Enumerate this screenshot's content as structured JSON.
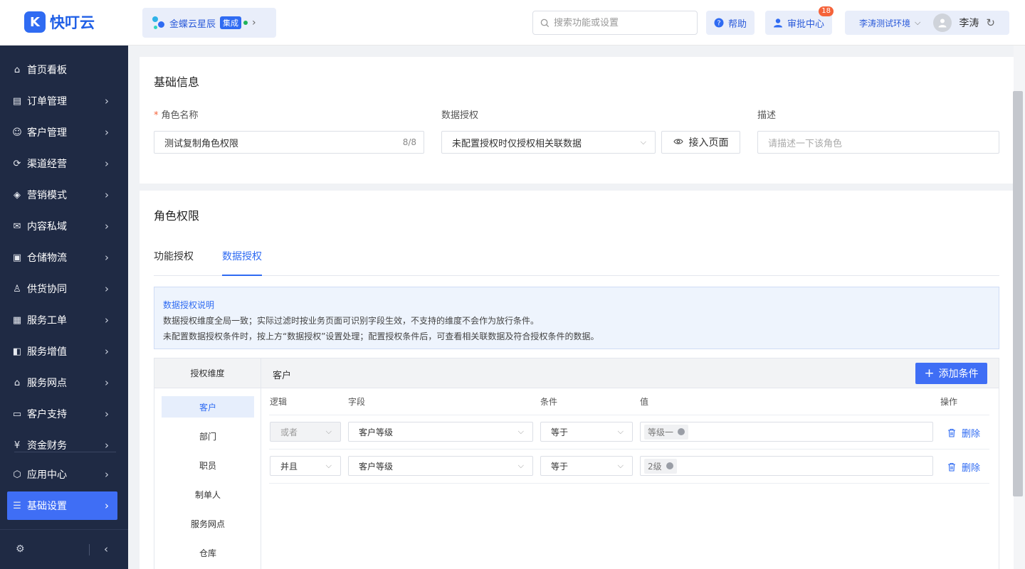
{
  "app": {
    "logo_text": "快叮云",
    "logo_mark": "K"
  },
  "topbar": {
    "integration_name": "金蝶云星辰",
    "integration_tag": "集成",
    "search_placeholder": "搜索功能或设置",
    "help_label": "帮助",
    "approval_label": "审批中心",
    "approval_badge": "18",
    "env_name": "李涛测试环境",
    "user_name": "李涛"
  },
  "sidebar": {
    "items": [
      {
        "label": "首页看板",
        "icon": "home-icon",
        "glyph": "⌂"
      },
      {
        "label": "订单管理",
        "icon": "order-icon",
        "glyph": "▤"
      },
      {
        "label": "客户管理",
        "icon": "customer-icon",
        "glyph": "☺"
      },
      {
        "label": "渠道经营",
        "icon": "channel-icon",
        "glyph": "⟳"
      },
      {
        "label": "营销模式",
        "icon": "tag-icon",
        "glyph": "◈"
      },
      {
        "label": "内容私域",
        "icon": "mail-icon",
        "glyph": "✉"
      },
      {
        "label": "仓储物流",
        "icon": "warehouse-icon",
        "glyph": "▣"
      },
      {
        "label": "供货协同",
        "icon": "supply-icon",
        "glyph": "♙"
      },
      {
        "label": "服务工单",
        "icon": "ticket-icon",
        "glyph": "▦"
      },
      {
        "label": "服务增值",
        "icon": "bag-icon",
        "glyph": "◧"
      },
      {
        "label": "服务网点",
        "icon": "store-icon",
        "glyph": "⌂"
      },
      {
        "label": "客户支持",
        "icon": "support-icon",
        "glyph": "▭"
      },
      {
        "label": "资金财务",
        "icon": "yen-icon",
        "glyph": "¥"
      },
      {
        "label": "应用中心",
        "icon": "app-icon",
        "glyph": "⬡"
      },
      {
        "label": "基础设置",
        "icon": "settings-list-icon",
        "glyph": "☰"
      }
    ],
    "active_index": 14
  },
  "basic_info": {
    "title": "基础信息",
    "role_name_label": "角色名称",
    "role_name_value": "测试复制角色权限",
    "role_name_count": "8/8",
    "data_auth_label": "数据授权",
    "data_auth_value": "未配置授权时仅授权相关联数据",
    "access_page_label": "接入页面",
    "desc_label": "描述",
    "desc_placeholder": "请描述一下该角色"
  },
  "role_perm": {
    "title": "角色权限",
    "tabs": [
      "功能授权",
      "数据授权"
    ],
    "active_tab": 1,
    "notice": {
      "title": "数据授权说明",
      "line1": "数据授权维度全局一致；实际过滤时按业务页面可识别字段生效，不支持的维度不会作为放行条件。",
      "line2": "未配置数据授权条件时，按上方“数据授权”设置处理；配置授权条件后，可查看相关联数据及符合授权条件的数据。"
    },
    "dim_header": "授权维度",
    "dims": [
      "客户",
      "部门",
      "职员",
      "制单人",
      "服务网点",
      "仓库"
    ],
    "active_dim": 0,
    "rule_title": "客户",
    "add_label": "添加条件",
    "columns": {
      "logic": "逻辑",
      "field": "字段",
      "cond": "条件",
      "value": "值",
      "op": "操作"
    },
    "rows": [
      {
        "logic": "或者",
        "field": "客户等级",
        "cond": "等于",
        "value": "等级一",
        "delete": "删除",
        "logic_disabled": true
      },
      {
        "logic": "并且",
        "field": "客户等级",
        "cond": "等于",
        "value": "2级",
        "delete": "删除",
        "logic_disabled": false
      }
    ]
  },
  "colors": {
    "primary": "#3f6ef5",
    "sidebar_bg": "#1f2a44",
    "badge": "#f5633a"
  }
}
